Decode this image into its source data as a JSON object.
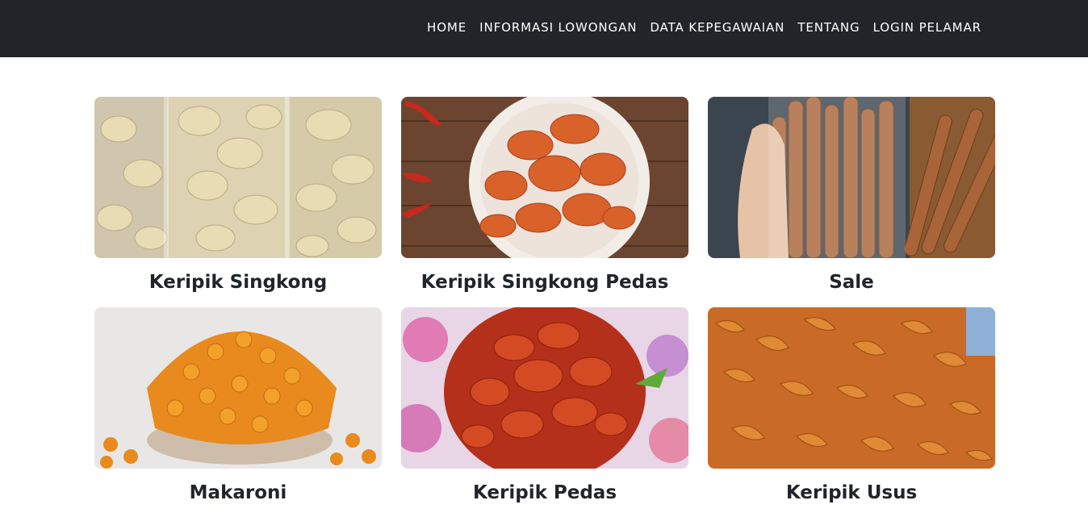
{
  "nav": {
    "items": [
      {
        "label": "HOME"
      },
      {
        "label": "INFORMASI LOWONGAN"
      },
      {
        "label": "DATA KEPEGAWAIAN"
      },
      {
        "label": "TENTANG"
      },
      {
        "label": "LOGIN PELAMAR"
      }
    ]
  },
  "products": [
    {
      "title": "Keripik Singkong",
      "image": "cassava-chips-in-plastic-bags"
    },
    {
      "title": "Keripik Singkong Pedas",
      "image": "spicy-cassava-chips-on-plate"
    },
    {
      "title": "Sale",
      "image": "banana-sale-sticks-in-bag"
    },
    {
      "title": "Makaroni",
      "image": "spicy-macaroni-in-bowl"
    },
    {
      "title": "Keripik Pedas",
      "image": "spicy-chips-on-floral-plate"
    },
    {
      "title": "Keripik Usus",
      "image": "fried-chicken-intestine-chips"
    }
  ],
  "colors": {
    "navbar": "#212529",
    "nav_text": "#ffffff",
    "title_text": "#212529"
  }
}
